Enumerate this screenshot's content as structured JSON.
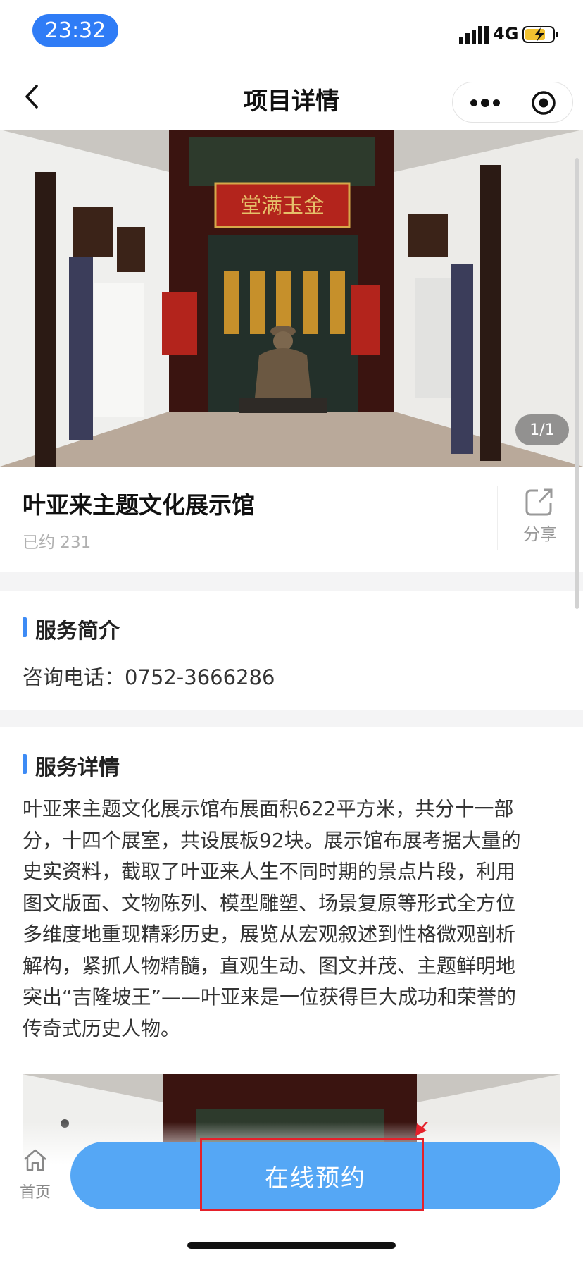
{
  "status": {
    "time": "23:32",
    "network": "4G",
    "battery_icon": "battery-charging-icon",
    "signal_icon": "signal-bars-icon"
  },
  "nav": {
    "title": "项目详情",
    "back_icon": "chevron-left-icon",
    "more_icon": "more-dots-icon",
    "close_icon": "target-circle-icon"
  },
  "hero": {
    "counter": "1/1"
  },
  "venue": {
    "name": "叶亚来主题文化展示馆",
    "booked": "已约 231",
    "share_label": "分享",
    "share_icon": "share-icon"
  },
  "intro": {
    "heading": "服务简介",
    "phone": "咨询电话：0752-3666286"
  },
  "detail": {
    "heading": "服务详情",
    "lines": [
      "叶亚来主题文化展示馆布展面积622平方米，共分十一部",
      "分，十四个展室，共设展板92块。展示馆布展考据大量的",
      "史实资料，截取了叶亚来人生不同时期的景点片段，利用",
      "图文版面、文物陈列、模型雕塑、场景复原等形式全方位",
      "多维度地重现精彩历史，展览从宏观叙述到性格微观剖析",
      "解构，紧抓人物精髓，直观生动、图文并茂、主题鲜明地",
      "突出“吉隆坡王”——叶亚来是一位获得巨大成功和荣誉的",
      "传奇式历史人物。"
    ]
  },
  "tabbar": {
    "home_label": "首页",
    "home_icon": "home-icon",
    "book_label": "在线预约"
  },
  "colors": {
    "accent": "#3d8bf5",
    "button": "#55a7f5",
    "highlight": "#e5212b",
    "time_pill": "#2f7cf6"
  }
}
